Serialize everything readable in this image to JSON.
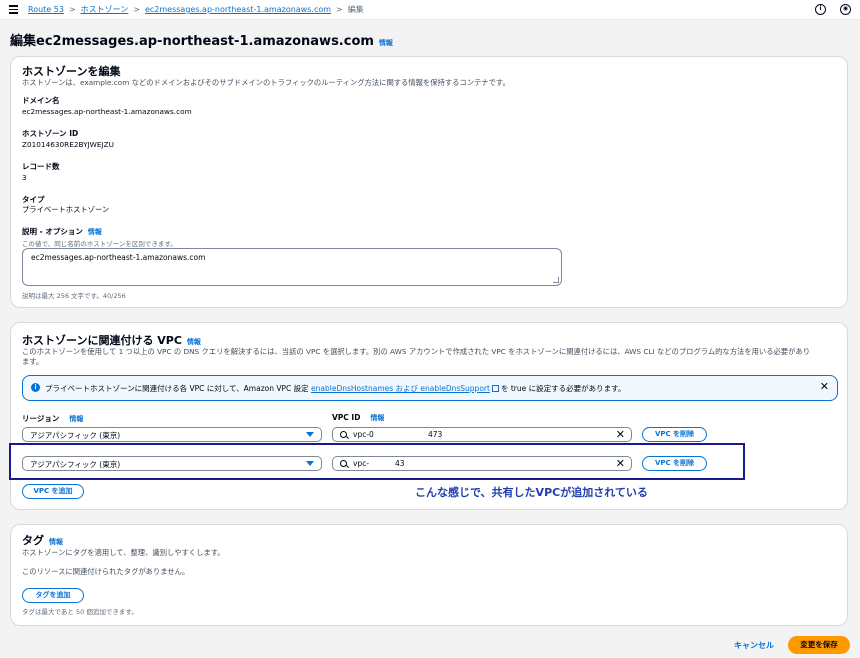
{
  "breadcrumb": {
    "items": [
      "Route 53",
      "ホストゾーン",
      "ec2messages.ap-northeast-1.amazonaws.com"
    ],
    "current": "編集"
  },
  "page": {
    "title": "編集ec2messages.ap-northeast-1.amazonaws.com",
    "info": "情報"
  },
  "hosted_zone": {
    "heading": "ホストゾーンを編集",
    "description": "ホストゾーンは、example.com などのドメインおよびそのサブドメインのトラフィックのルーティング方法に関する情報を保持するコンテナです。",
    "domain_label": "ドメイン名",
    "domain_value": "ec2messages.ap-northeast-1.amazonaws.com",
    "id_label": "ホストゾーン ID",
    "id_value": "Z01014630RE2BYJWEJZU",
    "records_label": "レコード数",
    "records_value": "3",
    "type_label": "タイプ",
    "type_value": "プライベートホストゾーン",
    "desc_label": "説明 - オプション",
    "desc_info": "情報",
    "desc_hint": "この値で、同じ名前のホストゾーンを区別できます。",
    "desc_value": "ec2messages.ap-northeast-1.amazonaws.com",
    "desc_limit": "説明は最大 256 文字です。40/256"
  },
  "vpc": {
    "heading": "ホストゾーンに関連付ける VPC",
    "info": "情報",
    "description_line1": "このホストゾーンを使用して 1 つ以上の VPC の DNS クエリを解決するには、当該の VPC を選択します。別の AWS アカウントで作成された VPC をホストゾーンに関連付けるには、AWS CLI などのプログラム的な方法を用いる必要があり",
    "description_line2": "ます。",
    "alert": {
      "text_before": "プライベートホストゾーンに関連付ける各 VPC に対して、Amazon VPC 設定",
      "link": "enableDnsHostnames および enableDnsSupport",
      "text_after": "を true に設定する必要があります。"
    },
    "region_label": "リージョン",
    "region_info": "情報",
    "vpcid_label": "VPC ID",
    "vpcid_info": "情報",
    "rows": [
      {
        "region": "アジアパシフィック (東京)",
        "vpc_prefix": "vpc-0",
        "vpc_suffix": "473",
        "remove_label": "VPC を削除"
      },
      {
        "region": "アジアパシフィック (東京)",
        "vpc_prefix": "vpc-",
        "vpc_suffix": "43",
        "remove_label": "VPC を削除"
      }
    ],
    "add_label": "VPC を追加"
  },
  "annotation": "こんな感じで、共有したVPCが追加されている",
  "tags": {
    "heading": "タグ",
    "info": "情報",
    "description": "ホストゾーンにタグを適用して、整理、識別しやすくします。",
    "empty": "このリソースに関連付けられたタグがありません。",
    "add_label": "タグを追加",
    "limit": "タグは最大であと 50 個追加できます。"
  },
  "footer": {
    "cancel_label": "キャンセル",
    "save_label": "変更を保存"
  },
  "colors": {
    "accent": "#0972d3",
    "primary_button": "#ff9900",
    "annotation": "#1f3fb0"
  }
}
